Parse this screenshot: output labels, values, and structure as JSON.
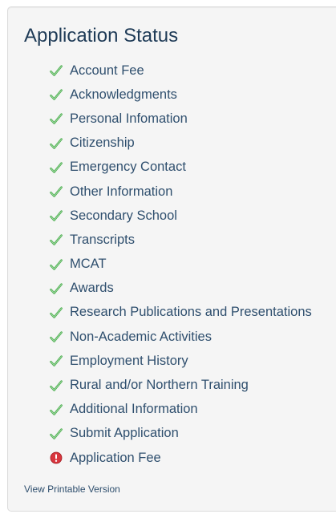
{
  "panel": {
    "title": "Application Status",
    "print_link": "View Printable Version"
  },
  "colors": {
    "check": "#4caf50",
    "error": "#d9363e",
    "text": "#2f4f6e",
    "title": "#1f3b57"
  },
  "status_items": [
    {
      "label": "Account Fee",
      "status": "complete",
      "icon": "check-icon"
    },
    {
      "label": "Acknowledgments",
      "status": "complete",
      "icon": "check-icon"
    },
    {
      "label": "Personal Infomation",
      "status": "complete",
      "icon": "check-icon"
    },
    {
      "label": "Citizenship",
      "status": "complete",
      "icon": "check-icon"
    },
    {
      "label": "Emergency Contact",
      "status": "complete",
      "icon": "check-icon"
    },
    {
      "label": "Other Information",
      "status": "complete",
      "icon": "check-icon"
    },
    {
      "label": "Secondary School",
      "status": "complete",
      "icon": "check-icon"
    },
    {
      "label": "Transcripts",
      "status": "complete",
      "icon": "check-icon"
    },
    {
      "label": "MCAT",
      "status": "complete",
      "icon": "check-icon"
    },
    {
      "label": "Awards",
      "status": "complete",
      "icon": "check-icon"
    },
    {
      "label": "Research Publications and Presentations",
      "status": "complete",
      "icon": "check-icon"
    },
    {
      "label": "Non-Academic Activities",
      "status": "complete",
      "icon": "check-icon"
    },
    {
      "label": "Employment History",
      "status": "complete",
      "icon": "check-icon"
    },
    {
      "label": "Rural and/or Northern Training",
      "status": "complete",
      "icon": "check-icon"
    },
    {
      "label": "Additional Information",
      "status": "complete",
      "icon": "check-icon"
    },
    {
      "label": "Submit Application",
      "status": "complete",
      "icon": "check-icon"
    },
    {
      "label": "Application Fee",
      "status": "incomplete",
      "icon": "error-icon"
    }
  ]
}
